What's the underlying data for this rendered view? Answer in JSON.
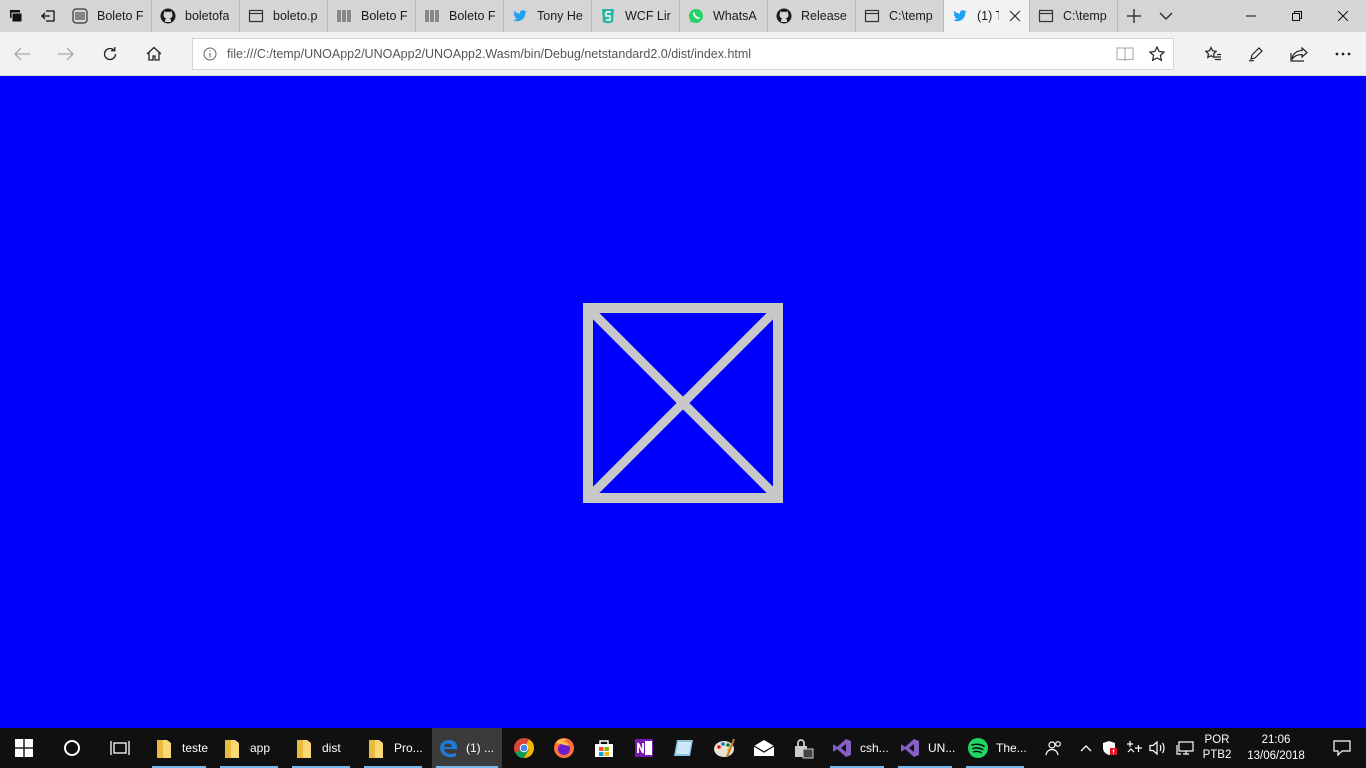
{
  "browser": {
    "tabs": [
      {
        "icon": "barcode-icon",
        "label": "Boleto F"
      },
      {
        "icon": "github-icon",
        "label": "boletofa"
      },
      {
        "icon": "page-icon",
        "label": "boleto.p"
      },
      {
        "icon": "barcode-icon",
        "label": "Boleto F"
      },
      {
        "icon": "barcode-icon",
        "label": "Boleto F"
      },
      {
        "icon": "twitter-icon",
        "label": "Tony He"
      },
      {
        "icon": "wcf-icon",
        "label": "WCF Lir"
      },
      {
        "icon": "whatsapp-icon",
        "label": "WhatsA"
      },
      {
        "icon": "github-icon",
        "label": "Release"
      },
      {
        "icon": "page-icon",
        "label": "C:\\temp"
      },
      {
        "icon": "twitter-icon",
        "label": "(1) T"
      },
      {
        "icon": "page-icon",
        "label": "C:\\temp"
      }
    ],
    "active_tab_index": 10,
    "address_url": "file:///C:/temp/UNOApp2/UNOApp2/UNOApp2.Wasm/bin/Debug/netstandard2.0/dist/index.html",
    "colors": {
      "tabstrip": "#d5d5d5",
      "active_tab": "#f2f2f2",
      "twitter": "#1da1f2"
    }
  },
  "page": {
    "background": "#0000ff",
    "content": "broken-image-placeholder-icon"
  },
  "taskbar": {
    "apps": [
      {
        "icon": "folder-icon",
        "label": "teste"
      },
      {
        "icon": "folder-icon",
        "label": "app"
      },
      {
        "icon": "folder-icon",
        "label": "dist"
      },
      {
        "icon": "folder-icon",
        "label": "Pro..."
      },
      {
        "icon": "edge-icon",
        "label": "(1) ..."
      }
    ],
    "pinned_icons": [
      "chrome-icon",
      "firefox-icon",
      "store-icon",
      "onenote-icon",
      "sticky-notes-icon",
      "paint-icon",
      "mail-icon",
      "security-icon"
    ],
    "apps_right": [
      {
        "icon": "visual-studio-icon",
        "label": "csh..."
      },
      {
        "icon": "visual-studio-icon",
        "label": "UN..."
      },
      {
        "icon": "spotify-icon",
        "label": "The..."
      }
    ],
    "language": {
      "line1": "POR",
      "line2": "PTB2"
    },
    "clock": {
      "time": "21:06",
      "date": "13/06/2018"
    }
  }
}
